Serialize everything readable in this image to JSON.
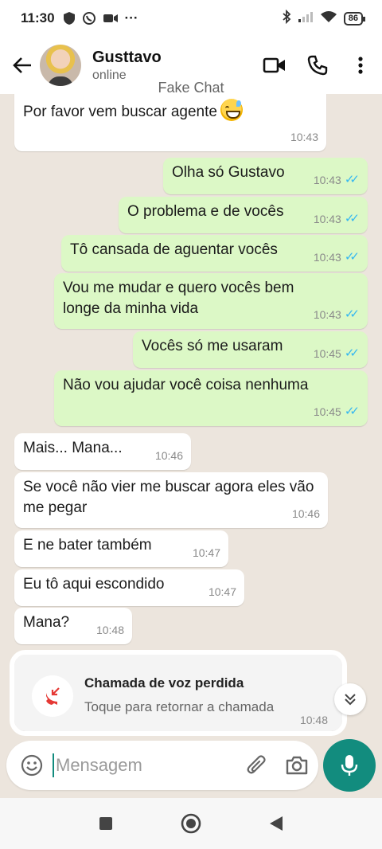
{
  "status_bar": {
    "time": "11:30",
    "more": "···",
    "battery": "86",
    "icons": [
      "shield-icon",
      "whatsapp-icon",
      "video-notif-icon",
      "bluetooth-icon",
      "signal-icon",
      "wifi-icon",
      "battery-icon"
    ]
  },
  "header": {
    "contact_name": "Gusttavo",
    "contact_status": "online",
    "watermark": "Fake Chat",
    "icons": [
      "back-arrow-icon",
      "video-call-icon",
      "phone-icon",
      "more-vert-icon"
    ]
  },
  "messages": [
    {
      "dir": "in",
      "text": "Por favor vem buscar agente",
      "time": "10:43",
      "emoji": "grinning-sweat"
    },
    {
      "dir": "out",
      "text": "Olha só Gustavo",
      "time": "10:43",
      "read": "✓✓"
    },
    {
      "dir": "out",
      "text": "O problema e de vocês",
      "time": "10:43",
      "read": "✓✓"
    },
    {
      "dir": "out",
      "text": "Tô cansada de aguentar vocês",
      "time": "10:43",
      "read": "✓✓"
    },
    {
      "dir": "out",
      "text": "Vou me mudar e quero vocês bem longe da minha vida",
      "time": "10:43",
      "read": "✓✓"
    },
    {
      "dir": "out",
      "text": "Vocês só me usaram",
      "time": "10:45",
      "read": "✓✓"
    },
    {
      "dir": "out",
      "text": "Não vou ajudar você coisa nenhuma",
      "time": "10:45",
      "read": "✓✓"
    },
    {
      "dir": "in",
      "text": "Mais... Mana...",
      "time": "10:46"
    },
    {
      "dir": "in",
      "text": "Se você não vier me buscar agora eles vão me pegar",
      "time": "10:46"
    },
    {
      "dir": "in",
      "text": "E ne bater também",
      "time": "10:47"
    },
    {
      "dir": "in",
      "text": "Eu tô aqui escondido",
      "time": "10:47"
    },
    {
      "dir": "in",
      "text": "Mana?",
      "time": "10:48"
    }
  ],
  "missed_call": {
    "title": "Chamada de voz perdida",
    "subtitle": "Toque para retornar a chamada",
    "time": "10:48"
  },
  "composer": {
    "placeholder": "Mensagem",
    "icons": [
      "emoji-icon",
      "attach-icon",
      "camera-icon",
      "mic-icon"
    ]
  },
  "colors": {
    "accent": "#128c7e",
    "outgoing_bubble": "#dcf8c6",
    "incoming_bubble": "#ffffff",
    "chat_bg": "#ece5dd",
    "read_ticks": "#34b7f1",
    "missed_call": "#e53935"
  }
}
